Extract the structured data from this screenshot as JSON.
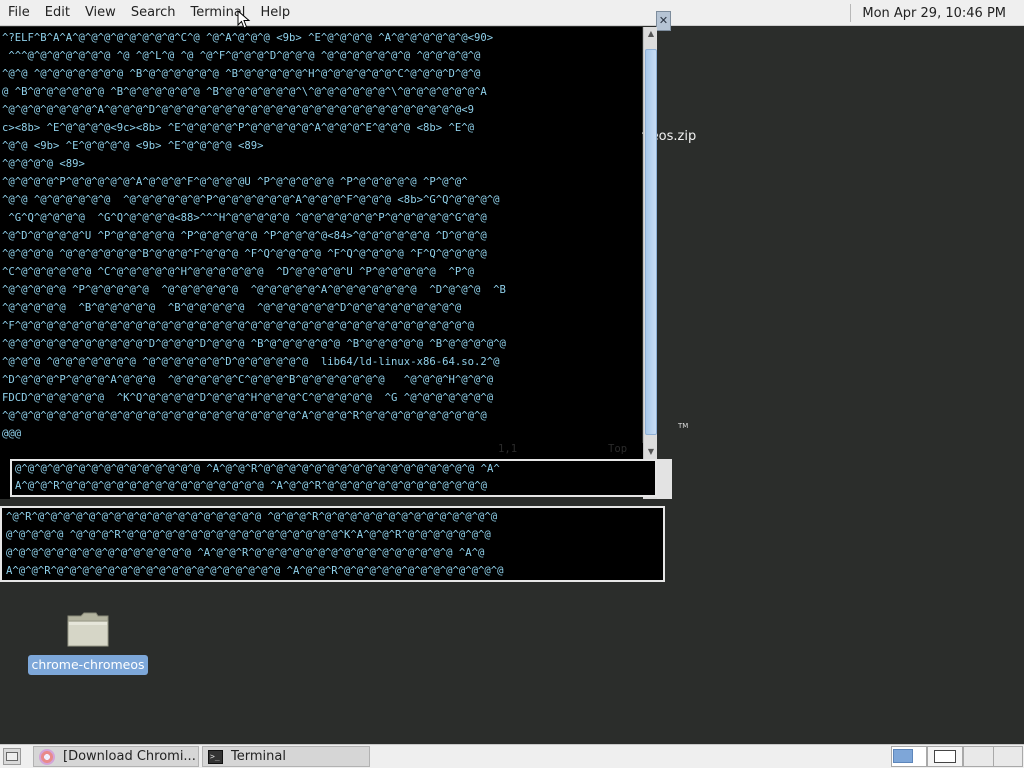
{
  "menubar": {
    "items": [
      "File",
      "Edit",
      "View",
      "Search",
      "Terminal",
      "Help"
    ]
  },
  "top_panel": {
    "clock": "Mon Apr 29, 10:46 PM"
  },
  "desktop": {
    "zip_label": "meos.zip",
    "tm_mark": "TM",
    "folder_label": "chrome-chromeos"
  },
  "terminal_main": {
    "close_glyph": "✕",
    "lines": [
      "^?ELF^B^A^A^@^@^@^@^@^@^@^@^C^@ ^@^A^@^@^@ <9b> ^E^@^@^@^@ ^A^@^@^@^@^@^@<90>",
      " ^^^@^@^@^@^@^@^@ ^@ ^@^L^@ ^@ ^@^F^@^@^@^D^@^@^@ ^@^@^@^@^@^@^@ ^@^@^@^@^@",
      "^@^@ ^@^@^@^@^@^@^@ ^B^@^@^@^@^@^@ ^B^@^@^@^@^@^H^@^@^@^@^@^@^C^@^@^@^D^@^@",
      "@ ^B^@^@^@^@^@^@ ^B^@^@^@^@^@^@ ^B^@^@^@^@^@^@^\\^@^@^@^@^@^@^\\^@^@^@^@^@^@^A",
      "^@^@^@^@^@^@^@^A^@^@^@^D^@^@^@^@^@^@^@^@^@^@^@^@^@^@^@^@^@^@^@^@^@^@^@^@<9",
      "c><8b> ^E^@^@^@^@<9c><8b> ^E^@^@^@^@^P^@^@^@^@^@^A^@^@^@^E^@^@^@ <8b> ^E^@",
      "^@^@ <9b> ^E^@^@^@^@ <9b> ^E^@^@^@^@ <89>",
      "^@^@^@^@ <89>",
      "^@^@^@^@^P^@^@^@^@^@^A^@^@^@^F^@^@^@^@U ^P^@^@^@^@^@ ^P^@^@^@^@^@ ^P^@^@^",
      "^@^@ ^@^@^@^@^@^@  ^@^@^@^@^@^@^P^@^@^@^@^@^@^A^@^@^@^F^@^@^@ <8b>^G^Q^@^@^@^@",
      " ^G^Q^@^@^@^@  ^G^Q^@^@^@^@<88>^^^H^@^@^@^@^@ ^@^@^@^@^@^@^P^@^@^@^@^@^G^@^@",
      "^@^D^@^@^@^@^U ^P^@^@^@^@^@ ^P^@^@^@^@^@ ^P^@^@^@^@<84>^@^@^@^@^@^@ ^D^@^@^@",
      "^@^@^@^@ ^@^@^@^@^@^@^B^@^@^@^F^@^@^@ ^F^Q^@^@^@^@ ^F^Q^@^@^@^@ ^F^Q^@^@^@^@",
      "^C^@^@^@^@^@^@ ^C^@^@^@^@^@^H^@^@^@^@^@^@  ^D^@^@^@^@^U ^P^@^@^@^@^@  ^P^@",
      "^@^@^@^@^@ ^P^@^@^@^@^@  ^@^@^@^@^@^@  ^@^@^@^@^@^A^@^@^@^@^@^@^@  ^D^@^@^@  ^B",
      "^@^@^@^@^@  ^B^@^@^@^@^@  ^B^@^@^@^@^@  ^@^@^@^@^@^@^D^@^@^@^@^@^@^@^@^@",
      "^F^@^@^@^@^@^@^@^@^@^@^@^@^@^@^@^@^@^@^@^@^@^@^@^@^@^@^@^@^@^@^@^@^@^@^@^@",
      "^@^@^@^@^@^@^@^@^@^@^@^D^@^@^@^D^@^@^@ ^B^@^@^@^@^@^@ ^B^@^@^@^@^@ ^B^@^@^@^@^@",
      "^@^@^@ ^@^@^@^@^@^@^@ ^@^@^@^@^@^@^D^@^@^@^@^@^@  lib64/ld-linux-x86-64.so.2^@",
      "^D^@^@^@^P^@^@^@^A^@^@^@  ^@^@^@^@^@^C^@^@^@^B^@^@^@^@^@^@^@   ^@^@^@^H^@^@^@",
      "FDCD^@^@^@^@^@^@  ^K^Q^@^@^@^@^D^@^@^@^H^@^@^@^C^@^@^@^@^@  ^G ^@^@^@^@^@^@^@",
      "^@^@^@^@^@^@^@^@^@^@^@^@^@^@^@^@^@^@^@^@^@^@^@^A^@^@^@^R^@^@^@^@^@^@^@^@^@^@",
      "@@@"
    ],
    "status_position": "1,1",
    "status_top": "Top"
  },
  "terminal_second": {
    "lines": [
      "@^@^@^@^@^@^@^@^@^@^@^@^@^@^@ ^A^@^@^R^@^@^@^@^@^@^@^@^@^@^@^@^@^@^@^@^@ ^A^",
      "A^@^@^R^@^@^@^@^@^@^@^@^@^@^@^@^@^@^@^@ ^A^@^@^R^@^@^@^@^@^@^@^@^@^@^@^@^@"
    ]
  },
  "terminal_third": {
    "lines": [
      "^@^R^@^@^@^@^@^@^@^@^@^@^@^@^@^@^@^@^@^@ ^@^@^@^R^@^@^@^@^@^@^@^@^@^@^@^@^@^@",
      "@^@^@^@^@ ^@^@^@^R^@^@^@^@^@^@^@^@^@^@^@^@^@^@^@^@^@^K^A^@^@^R^@^@^@^@^@^@^@",
      "@^@^@^@^@^@^@^@^@^@^@^@^@^@^@ ^A^@^@^R^@^@^@^@^@^@^@^@^@^@^@^@^@^@^@^@ ^A^@",
      "A^@^@^R^@^@^@^@^@^@^@^@^@^@^@^@^@^@^@^@^@^@ ^A^@^@^R^@^@^@^@^@^@^@^@^@^@^@^@^@"
    ]
  },
  "taskbar": {
    "chromium_label": "[Download Chromi...",
    "terminal_label": "Terminal",
    "terminal_icon_glyph": ">_"
  }
}
